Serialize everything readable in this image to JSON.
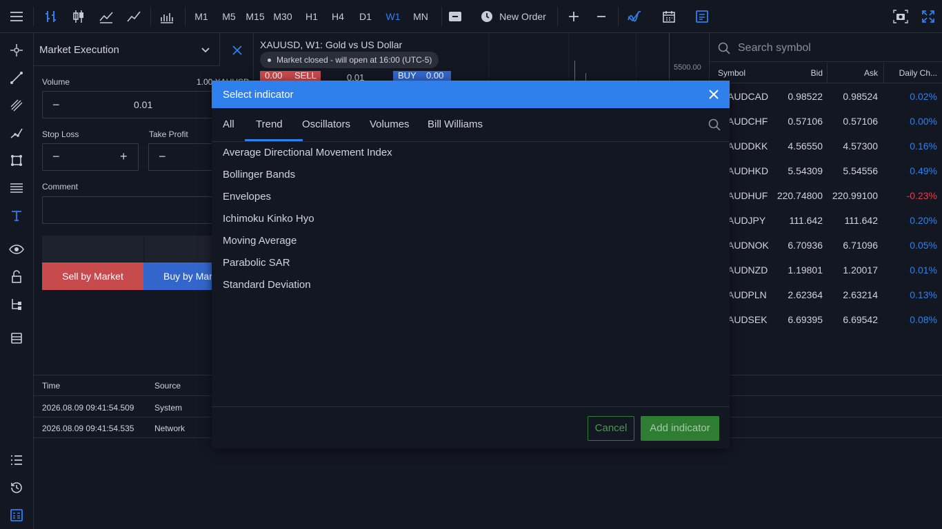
{
  "toolbar": {
    "timeframes": [
      "M1",
      "M5",
      "M15",
      "M30",
      "H1",
      "H4",
      "D1",
      "W1",
      "MN"
    ],
    "active_timeframe": "W1",
    "new_order_label": "New Order",
    "accent_color": "#2f80ed"
  },
  "order_panel": {
    "title": "Market Execution",
    "volume_label": "Volume",
    "volume_value": "0.01",
    "volume_hint": "1.00 XAUUSD",
    "stop_loss_label": "Stop Loss",
    "take_profit_label": "Take Profit",
    "comment_label": "Comment",
    "sell_button": "Sell by Market",
    "buy_button": "Buy by Mar"
  },
  "chart": {
    "title": "XAUUSD, W1: Gold vs US Dollar",
    "market_status": "Market closed - will open at 16:00 (UTC-5)",
    "sell_price": "0.00",
    "sell_label": "SELL",
    "lot_value": "0.01",
    "buy_label": "BUY",
    "buy_price": "0.00",
    "price_tick": "5500.00"
  },
  "watch": {
    "search_placeholder": "Search symbol",
    "columns": {
      "symbol": "Symbol",
      "bid": "Bid",
      "ask": "Ask",
      "change": "Daily Ch..."
    },
    "rows": [
      {
        "symbol": "AUDCAD",
        "bid": "0.98522",
        "ask": "0.98524",
        "change": "0.02%",
        "dir": "up"
      },
      {
        "symbol": "AUDCHF",
        "bid": "0.57106",
        "ask": "0.57106",
        "change": "0.00%",
        "dir": "up"
      },
      {
        "symbol": "AUDDKK",
        "bid": "4.56550",
        "ask": "4.57300",
        "change": "0.16%",
        "dir": "up"
      },
      {
        "symbol": "AUDHKD",
        "bid": "5.54309",
        "ask": "5.54556",
        "change": "0.49%",
        "dir": "up"
      },
      {
        "symbol": "AUDHUF",
        "bid": "220.74800",
        "ask": "220.99100",
        "change": "-0.23%",
        "dir": "down"
      },
      {
        "symbol": "AUDJPY",
        "bid": "111.642",
        "ask": "111.642",
        "change": "0.20%",
        "dir": "up"
      },
      {
        "symbol": "AUDNOK",
        "bid": "6.70936",
        "ask": "6.71096",
        "change": "0.05%",
        "dir": "up"
      },
      {
        "symbol": "AUDNZD",
        "bid": "1.19801",
        "ask": "1.20017",
        "change": "0.01%",
        "dir": "up"
      },
      {
        "symbol": "AUDPLN",
        "bid": "2.62364",
        "ask": "2.63214",
        "change": "0.13%",
        "dir": "up"
      },
      {
        "symbol": "AUDSEK",
        "bid": "6.69395",
        "ask": "6.69542",
        "change": "0.08%",
        "dir": "up"
      }
    ],
    "up_color": "#2f80ed",
    "down_color": "#f23645"
  },
  "journal": {
    "columns": {
      "time": "Time",
      "source": "Source"
    },
    "rows": [
      {
        "time": "2026.08.09 09:41:54.509",
        "source": "System"
      },
      {
        "time": "2026.08.09 09:41:54.535",
        "source": "Network"
      }
    ]
  },
  "modal": {
    "title": "Select indicator",
    "tabs": [
      "All",
      "Trend",
      "Oscillators",
      "Volumes",
      "Bill Williams"
    ],
    "active_tab": "Trend",
    "indicators": [
      "Average Directional Movement Index",
      "Bollinger Bands",
      "Envelopes",
      "Ichimoku Kinko Hyo",
      "Moving Average",
      "Parabolic SAR",
      "Standard Deviation"
    ],
    "cancel_label": "Cancel",
    "add_label": "Add indicator",
    "add_color": "#2e7d32"
  }
}
